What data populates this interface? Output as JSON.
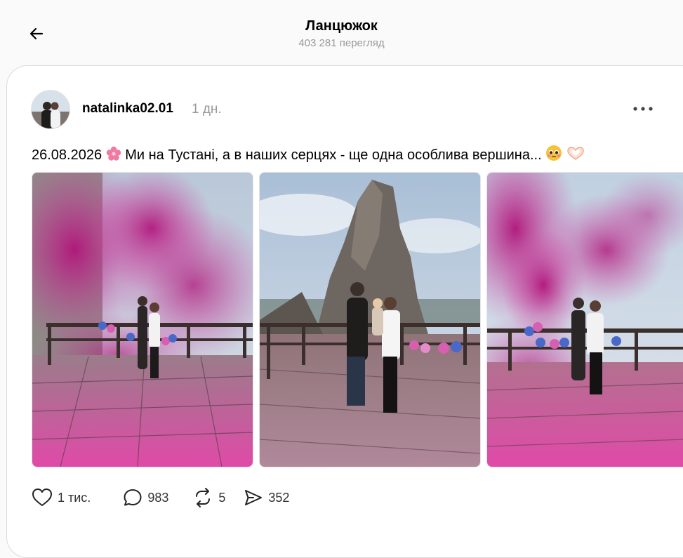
{
  "header": {
    "title": "Ланцюжок",
    "subtitle": "403 281 перегляд"
  },
  "post": {
    "username": "natalinka02.01",
    "time_ago": "1 дн.",
    "caption_date": "26.08.2026",
    "caption_text": "Ми на Тустані, а в наших серцях - ще одна особлива вершина...",
    "images": [
      {
        "alt": "couple-pink-smoke-photo"
      },
      {
        "alt": "couple-tustan-rock-photo"
      },
      {
        "alt": "couple-pink-smoke-photo-2"
      }
    ],
    "actions": {
      "likes": "1 тис.",
      "comments": "983",
      "reposts": "5",
      "shares": "352"
    }
  },
  "icons": {
    "back": "arrow-left-icon",
    "more": "more-dots-icon",
    "like": "heart-icon",
    "comment": "comment-icon",
    "repost": "repost-icon",
    "share": "send-icon"
  }
}
